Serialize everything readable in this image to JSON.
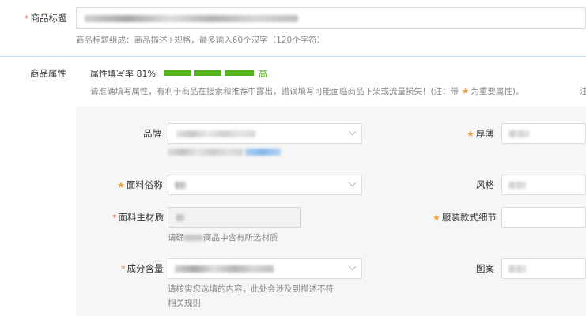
{
  "title_field": {
    "label": "商品标题",
    "required_mark": "*",
    "hint": "商品标题组成：商品描述+规格，最多输入60个汉字（120个字符）"
  },
  "attributes": {
    "section_label": "商品属性",
    "fill_rate_label": "属性填写率 81%",
    "fill_rate": 0.81,
    "fill_level": "高",
    "notice_prefix": "请准确填写属性，有利于商品在搜索和推荐中露出，错误填写可能面临商品下架或流量损失！(注：带",
    "notice_suffix": "为重要属性)。",
    "notice_edge": "注",
    "fields": {
      "brand": {
        "label": "品牌"
      },
      "thickness": {
        "label": "厚薄",
        "important": true
      },
      "fabric_name": {
        "label": "面料俗称",
        "important": true
      },
      "style": {
        "label": "风格"
      },
      "main_material": {
        "label": "面料主材质",
        "required_mark": "*",
        "hint_prefix": "请确",
        "hint_suffix": "商品中含有所选材质"
      },
      "garment_detail": {
        "label": "服装款式细节",
        "important": true
      },
      "composition": {
        "label": "成分含量",
        "required_mark": "*",
        "hint_line1": "请核实您选填的内容，此处会涉及到描述不符",
        "hint_line2": "相关规则"
      },
      "pattern": {
        "label": "图案"
      }
    }
  },
  "colors": {
    "accent_green": "#52b21e",
    "required_red": "#f25c3e",
    "important_orange": "#f2a33a",
    "link_blue": "#3a8ee6"
  },
  "icons": {
    "star": "★",
    "chevron": "chevron-down-icon"
  }
}
